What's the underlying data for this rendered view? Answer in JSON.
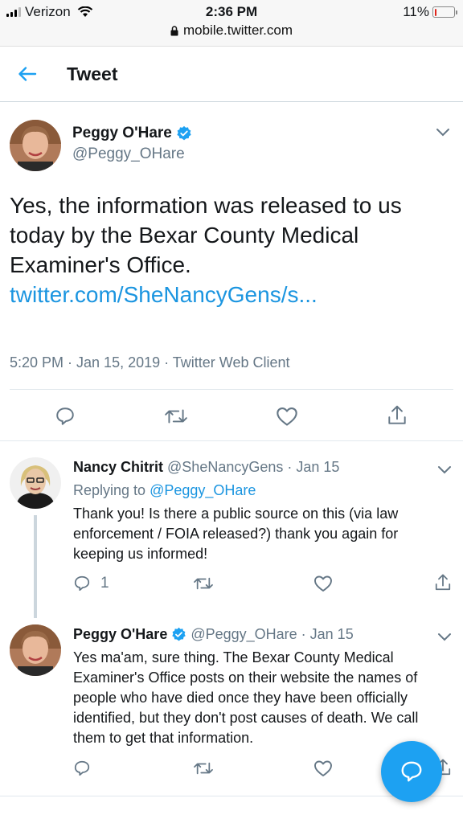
{
  "status_bar": {
    "carrier": "Verizon",
    "time": "2:36 PM",
    "url": "mobile.twitter.com",
    "battery": "11%",
    "battery_level": 0.11
  },
  "header": {
    "title": "Tweet"
  },
  "main_tweet": {
    "name": "Peggy O'Hare",
    "handle": "@Peggy_OHare",
    "text": "Yes, the information was released to us today by the Bexar County Medical Examiner's Office.",
    "link": "twitter.com/SheNancyGens/s...",
    "meta": "5:20 PM · Jan 15, 2019 · Twitter Web Client"
  },
  "replies": [
    {
      "name": "Nancy Chitrit",
      "handle": "@SheNancyGens · Jan 15",
      "replying_label": "Replying to",
      "replying_to": "@Peggy_OHare",
      "text": "Thank you! Is there a public source on this (via law enforcement / FOIA released?) thank you again for keeping us informed!",
      "reply_count": "1"
    },
    {
      "name": "Peggy O'Hare",
      "handle": "@Peggy_OHare · Jan 15",
      "text": "Yes ma'am, sure thing. The Bexar County Medical Examiner's Office posts on their website the names of people who have died once they have been officially identified, but they don't post causes of death. We call them to get that information."
    }
  ],
  "icons": {
    "back": "arrow-left-icon",
    "verified": "verified-badge-icon",
    "reply": "reply-icon",
    "retweet": "retweet-icon",
    "like": "heart-icon",
    "share": "share-icon",
    "compose": "compose-icon",
    "chevron": "chevron-down-icon"
  },
  "colors": {
    "accent": "#1da1f2",
    "link": "#1b95e0",
    "secondary_text": "#657786",
    "battery_low": "#e0241b"
  }
}
